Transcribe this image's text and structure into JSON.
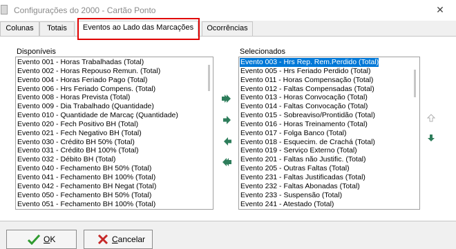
{
  "window": {
    "title": "Configurações do 2000 - Cartão Ponto",
    "close_glyph": "✕"
  },
  "tabs": [
    {
      "label": "Colunas"
    },
    {
      "label": "Totais"
    },
    {
      "label": "Eventos ao Lado das Marcações"
    },
    {
      "label": "Ocorrências"
    }
  ],
  "active_tab": "Eventos ao Lado das Marcações",
  "highlight_color": "#e00000",
  "available": {
    "label": "Disponíveis",
    "items": [
      "Evento 001 - Horas Trabalhadas (Total)",
      "Evento 002 - Horas Repouso Remun. (Total)",
      "Evento 004 - Horas Feriado Pago (Total)",
      "Evento 006 - Hrs Feriado Compens. (Total)",
      "Evento 008 - Horas Prevista (Total)",
      "Evento 009 - Dia Trabalhado (Quantidade)",
      "Evento 010 - Quantidade de Marcaç (Quantidade)",
      "Evento 020 - Fech Positivo BH (Total)",
      "Evento 021 - Fech Negativo BH (Total)",
      "Evento 030 - Crédito BH 50% (Total)",
      "Evento 031 - Crédito BH 100% (Total)",
      "Evento 032 - Débito BH (Total)",
      "Evento 040 - Fechamento BH 50% (Total)",
      "Evento 041 - Fechamento BH 100% (Total)",
      "Evento 042 - Fechamento BH Negat (Total)",
      "Evento 050 - Fechamento BH 50% (Total)",
      "Evento 051 - Fechamento BH 100% (Total)"
    ]
  },
  "selected": {
    "label": "Selecionados",
    "items": [
      "Evento 003 - Hrs Rep. Rem.Perdido (Total)",
      "Evento 005 - Hrs Feriado Perdido (Total)",
      "Evento 011 - Horas Compensação (Total)",
      "Evento 012 - Faltas Compensadas (Total)",
      "Evento 013 - Horas Convocação (Total)",
      "Evento 014 - Faltas Convocação (Total)",
      "Evento 015 - Sobreaviso/Prontidão (Total)",
      "Evento 016 - Horas Treinamento (Total)",
      "Evento 017 - Folga Banco (Total)",
      "Evento 018 - Esquecim. de Crachá (Total)",
      "Evento 019 - Serviço Externo (Total)",
      "Evento 201 - Faltas não Justific. (Total)",
      "Evento 205 - Outras Faltas (Total)",
      "Evento 231 - Faltas Justificadas (Total)",
      "Evento 232 - Faltas Abonadas (Total)",
      "Evento 233 - Suspensão (Total)",
      "Evento 241 - Atestado (Total)"
    ],
    "selected_index": 0,
    "selection_color": "#0078d7"
  },
  "arrow_color": "#2e7d5b",
  "buttons": {
    "ok_label": "OK",
    "cancel_label": "Cancelar"
  }
}
